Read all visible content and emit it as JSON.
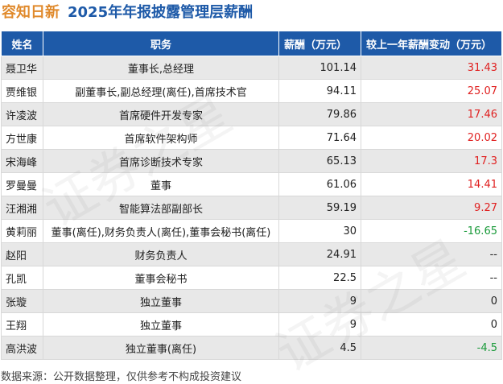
{
  "title": {
    "company": "容知日新",
    "rest": "2025年年报披露管理层薪酬"
  },
  "table": {
    "headers": [
      "姓名",
      "职务",
      "薪酬（万元）",
      "较上一年薪酬变动（万元）"
    ],
    "rows": [
      {
        "name": "聂卫华",
        "position": "董事长,总经理",
        "salary": "101.14",
        "change": "31.43"
      },
      {
        "name": "贾维银",
        "position": "副董事长,副总经理(离任),首席技术官",
        "salary": "94.11",
        "change": "25.07"
      },
      {
        "name": "许凌波",
        "position": "首席硬件开发专家",
        "salary": "79.86",
        "change": "17.46"
      },
      {
        "name": "方世康",
        "position": "首席软件架构师",
        "salary": "71.64",
        "change": "20.02"
      },
      {
        "name": "宋海峰",
        "position": "首席诊断技术专家",
        "salary": "65.13",
        "change": "17.3"
      },
      {
        "name": "罗曼曼",
        "position": "董事",
        "salary": "61.06",
        "change": "14.41"
      },
      {
        "name": "汪湘湘",
        "position": "智能算法部副部长",
        "salary": "59.19",
        "change": "9.27"
      },
      {
        "name": "黄莉丽",
        "position": "董事(离任),财务负责人(离任),董事会秘书(离任)",
        "salary": "30",
        "change": "-16.65"
      },
      {
        "name": "赵阳",
        "position": "财务负责人",
        "salary": "24.91",
        "change": "--"
      },
      {
        "name": "孔凯",
        "position": "董事会秘书",
        "salary": "22.5",
        "change": "--"
      },
      {
        "name": "张璇",
        "position": "独立董事",
        "salary": "9",
        "change": "0"
      },
      {
        "name": "王翔",
        "position": "独立董事",
        "salary": "9",
        "change": "0"
      },
      {
        "name": "高洪波",
        "position": "独立董事(离任)",
        "salary": "4.5",
        "change": "-4.5"
      }
    ]
  },
  "footer": "数据来源：公开数据整理，仅供参考不构成投资建议",
  "watermark": "证券之星",
  "colors": {
    "header_bg": "#1e5aa8",
    "company": "#e08a2c",
    "positive": "#e02020",
    "negative": "#1a9a3a",
    "neutral": "#222222"
  }
}
